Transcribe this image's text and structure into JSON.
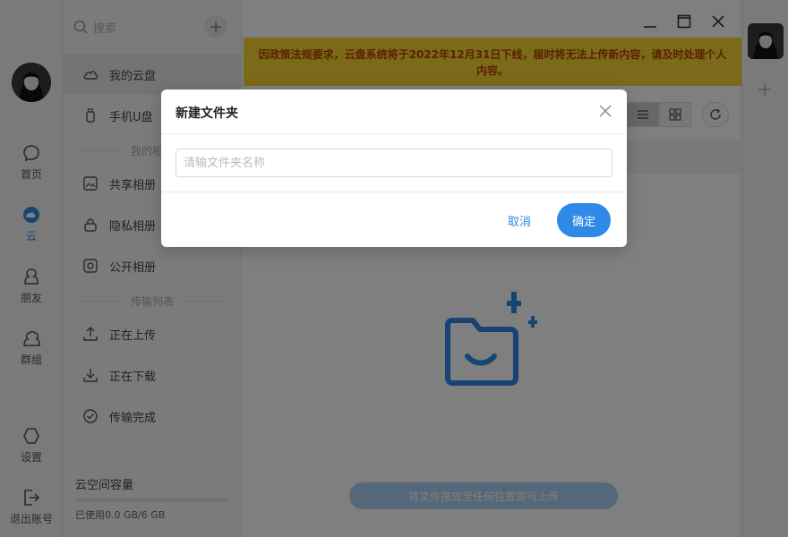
{
  "rail": {
    "items": [
      {
        "label": "首页",
        "icon": "chat-bubble-icon"
      },
      {
        "label": "云",
        "icon": "cloud-icon"
      },
      {
        "label": "朋友",
        "icon": "friend-icon"
      },
      {
        "label": "群组",
        "icon": "group-icon"
      },
      {
        "label": "设置",
        "icon": "hexagon-settings-icon"
      },
      {
        "label": "退出账号",
        "icon": "logout-icon"
      }
    ],
    "active_index": 1
  },
  "sidebar": {
    "search_placeholder": "搜索",
    "items": [
      {
        "label": "我的云盘",
        "icon": "cloud-icon"
      },
      {
        "label": "手机U盘",
        "icon": "usb-drive-icon"
      },
      {
        "label": "共享相册",
        "icon": "shared-album-icon"
      },
      {
        "label": "隐私相册",
        "icon": "lock-icon"
      },
      {
        "label": "公开相册",
        "icon": "camera-icon"
      },
      {
        "label": "正在上传",
        "icon": "upload-icon"
      },
      {
        "label": "正在下载",
        "icon": "download-icon"
      },
      {
        "label": "传输完成",
        "icon": "check-circle-icon"
      }
    ],
    "sections": {
      "album": "我的相册",
      "transfer": "传输列表"
    },
    "capacity": {
      "title": "云空间容量",
      "used_text": "已使用0.0 GB/6 GB",
      "used_fraction": 0.0
    }
  },
  "main": {
    "notice": "因政策法规要求，云盘系统将于2022年12月31日下线，届时将无法上传新内容，请及时处理个人内容。",
    "upload_hint": "将文件拖放至任何位置即可上传"
  },
  "dialog": {
    "title": "新建文件夹",
    "input_placeholder": "请输文件夹名称",
    "input_value": "",
    "cancel_label": "取消",
    "ok_label": "确定"
  },
  "colors": {
    "accent": "#2e8ae6",
    "notice_bg": "#f5d533",
    "notice_text": "#b54400"
  }
}
